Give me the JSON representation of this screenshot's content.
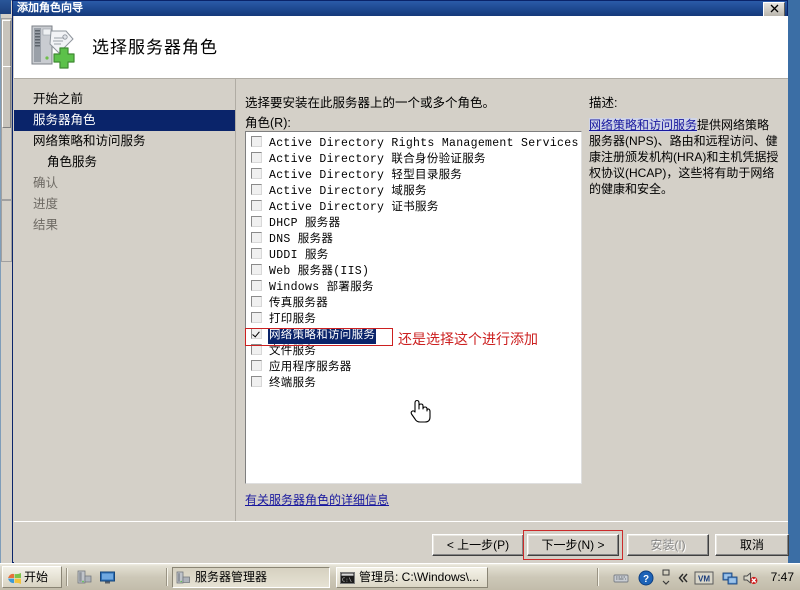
{
  "window": {
    "title": "添加角色向导",
    "close_label": "✕",
    "header_title": "选择服务器角色",
    "header_icon": "server-add-icon"
  },
  "sidebar": {
    "items": [
      {
        "label": "开始之前",
        "state": "normal"
      },
      {
        "label": "服务器角色",
        "state": "selected"
      },
      {
        "label": "网络策略和访问服务",
        "state": "normal"
      },
      {
        "label": "角色服务",
        "state": "sub"
      },
      {
        "label": "确认",
        "state": "dim"
      },
      {
        "label": "进度",
        "state": "dim"
      },
      {
        "label": "结果",
        "state": "dim"
      }
    ]
  },
  "main": {
    "intro": "选择要安装在此服务器上的一个或多个角色。",
    "roles_label": "角色(R):",
    "roles": [
      {
        "label": "Active Directory Rights Management Services",
        "checked": false,
        "selected": false
      },
      {
        "label": "Active Directory 联合身份验证服务",
        "checked": false,
        "selected": false
      },
      {
        "label": "Active Directory 轻型目录服务",
        "checked": false,
        "selected": false
      },
      {
        "label": "Active Directory 域服务",
        "checked": false,
        "selected": false
      },
      {
        "label": "Active Directory 证书服务",
        "checked": false,
        "selected": false
      },
      {
        "label": "DHCP 服务器",
        "checked": false,
        "selected": false
      },
      {
        "label": "DNS 服务器",
        "checked": false,
        "selected": false
      },
      {
        "label": "UDDI 服务",
        "checked": false,
        "selected": false
      },
      {
        "label": "Web 服务器(IIS)",
        "checked": false,
        "selected": false
      },
      {
        "label": "Windows 部署服务",
        "checked": false,
        "selected": false
      },
      {
        "label": "传真服务器",
        "checked": false,
        "selected": false
      },
      {
        "label": "打印服务",
        "checked": false,
        "selected": false
      },
      {
        "label": "网络策略和访问服务",
        "checked": true,
        "selected": true
      },
      {
        "label": "文件服务",
        "checked": false,
        "selected": false
      },
      {
        "label": "应用程序服务器",
        "checked": false,
        "selected": false
      },
      {
        "label": "终端服务",
        "checked": false,
        "selected": false
      }
    ],
    "annotation": "还是选择这个进行添加",
    "annotation_color": "#cc2020",
    "more_info_link": "有关服务器角色的详细信息"
  },
  "description": {
    "title": "描述:",
    "link_text": "网络策略和访问服务",
    "body": "提供网络策略服务器(NPS)、路由和远程访问、健康注册颁发机构(HRA)和主机凭据授权协议(HCAP)，这些将有助于网络的健康和安全。"
  },
  "footer": {
    "prev": "< 上一步(P)",
    "next": "下一步(N) >",
    "install": "安装(I)",
    "cancel": "取消",
    "next_highlight_color": "#cc2a2a"
  },
  "taskbar": {
    "start_label": "开始",
    "quick_launch": [
      "server-manager-icon",
      "show-desktop-icon"
    ],
    "tasks": [
      {
        "label": "服务器管理器",
        "icon": "server-manager-icon",
        "active": true
      },
      {
        "label": "管理员: C:\\Windows\\...",
        "icon": "console-icon",
        "active": false
      }
    ],
    "tray_icons": [
      "keyboard-icon",
      "help-icon",
      "chevron-expand-icon",
      "double-chevron-left-icon",
      "vm-icon",
      "network-icon",
      "speaker-muted-icon"
    ],
    "clock": "7:47"
  }
}
